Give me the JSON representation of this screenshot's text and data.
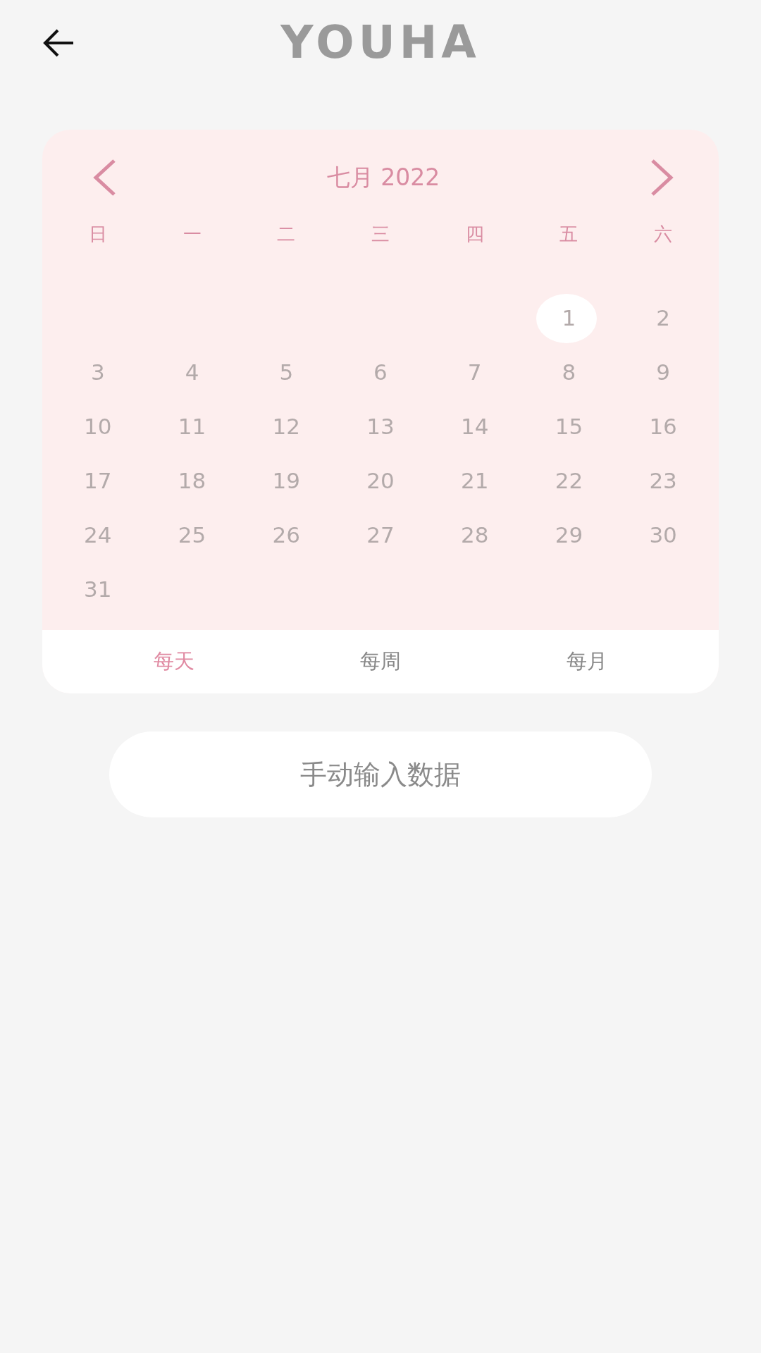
{
  "header": {
    "logo": "YOUHA"
  },
  "calendar": {
    "month": "七月 2022",
    "weekdays": [
      "日",
      "一",
      "二",
      "三",
      "四",
      "五",
      "六"
    ],
    "weeks": [
      [
        {
          "kind": "blank"
        },
        {
          "kind": "blank"
        },
        {
          "kind": "blank"
        },
        {
          "kind": "blank"
        },
        {
          "kind": "blank"
        },
        {
          "kind": "day",
          "label": "1",
          "selected": true
        },
        {
          "kind": "day",
          "label": "2",
          "selected": false
        }
      ],
      [
        {
          "kind": "day",
          "label": "3",
          "selected": false
        },
        {
          "kind": "day",
          "label": "4",
          "selected": false
        },
        {
          "kind": "day",
          "label": "5",
          "selected": false
        },
        {
          "kind": "day",
          "label": "6",
          "selected": false
        },
        {
          "kind": "day",
          "label": "7",
          "selected": false
        },
        {
          "kind": "day",
          "label": "8",
          "selected": false
        },
        {
          "kind": "day",
          "label": "9",
          "selected": false
        }
      ],
      [
        {
          "kind": "day",
          "label": "10",
          "selected": false
        },
        {
          "kind": "day",
          "label": "11",
          "selected": false
        },
        {
          "kind": "day",
          "label": "12",
          "selected": false
        },
        {
          "kind": "day",
          "label": "13",
          "selected": false
        },
        {
          "kind": "day",
          "label": "14",
          "selected": false
        },
        {
          "kind": "day",
          "label": "15",
          "selected": false
        },
        {
          "kind": "day",
          "label": "16",
          "selected": false
        }
      ],
      [
        {
          "kind": "day",
          "label": "17",
          "selected": false
        },
        {
          "kind": "day",
          "label": "18",
          "selected": false
        },
        {
          "kind": "day",
          "label": "19",
          "selected": false
        },
        {
          "kind": "day",
          "label": "20",
          "selected": false
        },
        {
          "kind": "day",
          "label": "21",
          "selected": false
        },
        {
          "kind": "day",
          "label": "22",
          "selected": false
        },
        {
          "kind": "day",
          "label": "23",
          "selected": false
        }
      ],
      [
        {
          "kind": "day",
          "label": "24",
          "selected": false
        },
        {
          "kind": "day",
          "label": "25",
          "selected": false
        },
        {
          "kind": "day",
          "label": "26",
          "selected": false
        },
        {
          "kind": "day",
          "label": "27",
          "selected": false
        },
        {
          "kind": "day",
          "label": "28",
          "selected": false
        },
        {
          "kind": "day",
          "label": "29",
          "selected": false
        },
        {
          "kind": "day",
          "label": "30",
          "selected": false
        }
      ],
      [
        {
          "kind": "day",
          "label": "31",
          "selected": false
        },
        {
          "kind": "blank"
        },
        {
          "kind": "blank"
        },
        {
          "kind": "blank"
        },
        {
          "kind": "blank"
        },
        {
          "kind": "blank"
        },
        {
          "kind": "blank"
        }
      ]
    ],
    "tabs": [
      {
        "label": "每天",
        "selected": true
      },
      {
        "label": "每周",
        "selected": false
      },
      {
        "label": "每月",
        "selected": false
      }
    ]
  },
  "manual_button": "手动输入数据"
}
